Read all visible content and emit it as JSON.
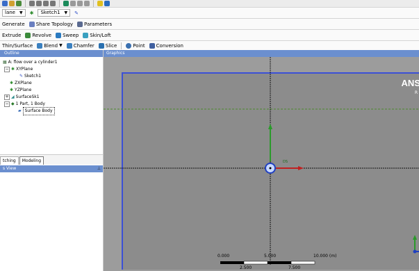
{
  "toolbar1": {
    "items": [
      "",
      "",
      ""
    ]
  },
  "toolbar2": {
    "plane_combo": "lane",
    "sketch_combo": "Sketch1"
  },
  "toolbar3": {
    "generate": "Generate",
    "share_topology": "Share Topology",
    "parameters": "Parameters"
  },
  "toolbar4": {
    "extrude": "Extrude",
    "revolve": "Revolve",
    "sweep": "Sweep",
    "skin_loft": "Skin/Loft"
  },
  "toolbar5": {
    "thin_surface": "Thin/Surface",
    "blend": "Blend",
    "chamfer": "Chamfer",
    "slice": "Slice",
    "point": "Point",
    "conversion": "Conversion"
  },
  "outline": {
    "header": "Outline",
    "nodes": [
      {
        "label": "A: flow over a cylinder1"
      },
      {
        "label": "XYPlane"
      },
      {
        "label": "Sketch1"
      },
      {
        "label": "ZXPlane"
      },
      {
        "label": "YZPlane"
      },
      {
        "label": "SurfaceSk1"
      },
      {
        "label": "1 Part, 1 Body"
      },
      {
        "label": "Surface Body"
      }
    ]
  },
  "tabs": {
    "sketching": "tching",
    "modeling": "Modeling"
  },
  "details": {
    "header": "s View"
  },
  "graphics": {
    "header": "Graphics",
    "brand": "ANS",
    "brand_sub": "R"
  },
  "scale": {
    "t0": "0.000",
    "t1": "5.000",
    "t2": "10.000 (m)",
    "b1": "2.500",
    "b2": "7.500"
  }
}
